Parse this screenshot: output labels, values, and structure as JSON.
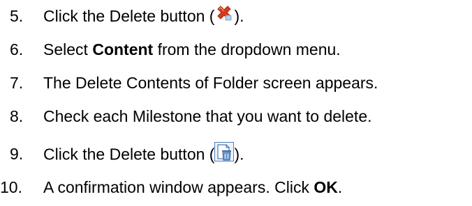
{
  "steps": [
    {
      "number": "5.",
      "parts": [
        "Click the Delete button (",
        ")."
      ],
      "icon": "delete-x-icon"
    },
    {
      "number": "6.",
      "parts": [
        "Select ",
        "Content",
        " from the dropdown menu."
      ]
    },
    {
      "number": "7.",
      "parts": [
        "The Delete Contents of Folder screen appears."
      ]
    },
    {
      "number": "8.",
      "parts": [
        "Check each Milestone that you want to delete."
      ]
    },
    {
      "number": "9.",
      "parts": [
        "Click the Delete button (",
        ")."
      ],
      "icon": "delete-trash-icon"
    },
    {
      "number": "10.",
      "parts": [
        "A confirmation window appears. Click ",
        "OK",
        "."
      ]
    }
  ],
  "colors": {
    "delete_x": "#d83a1d",
    "trash_blue": "#4c7fc0"
  }
}
